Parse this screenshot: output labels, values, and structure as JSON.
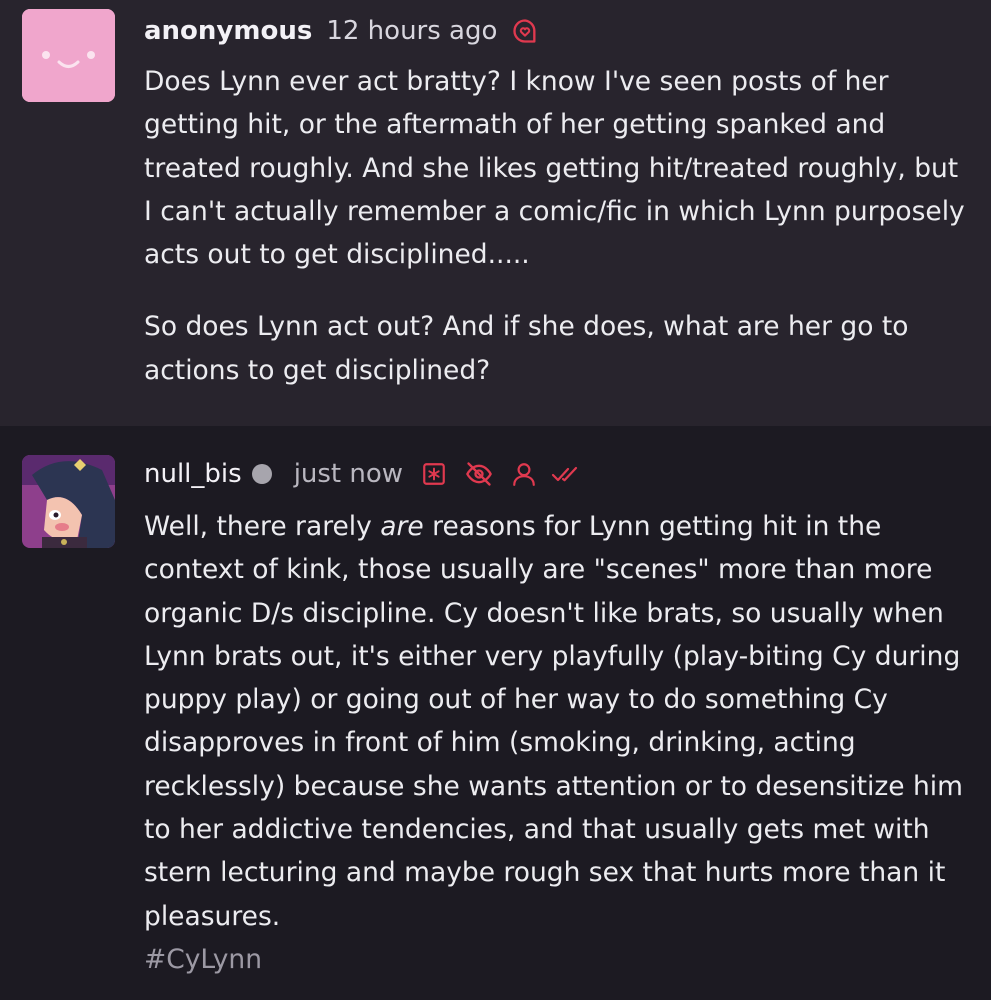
{
  "ask": {
    "username": "anonymous",
    "time": "12 hours ago",
    "paragraphs": [
      "Does Lynn ever act bratty? I know I've seen posts of her getting hit, or the aftermath of her getting spanked and treated roughly. And she likes getting hit/treated roughly, but I can't actually remember a comic/fic in which Lynn purposely acts out to get disciplined.....",
      "So does Lynn act out? And if she does, what are her go to actions to get disciplined?"
    ],
    "icons": {
      "avatar": "smiley-face-avatar",
      "ask": "speech-bubble-heart-icon"
    }
  },
  "answer": {
    "username": "null_bis",
    "time": "just now",
    "text_before": "Well, there rarely ",
    "emphasis": "are",
    "text_after": " reasons for Lynn getting hit in the context of kink, those usually are \"scenes\" more than more organic D/s discipline. Cy doesn't like brats, so usually when Lynn brats out, it's either very playfully (play-biting Cy during puppy play) or going out of her way to do something Cy disapproves in front of him (smoking, drinking, acting recklessly) because she wants attention or to desensitize him to her addictive tendencies, and that usually gets met with stern lecturing and maybe rough sex that hurts more than it pleasures.",
    "tag": "#CyLynn",
    "icons": [
      "asterisk-box-icon",
      "eye-off-icon",
      "user-icon",
      "double-check-icon"
    ]
  },
  "colors": {
    "accent": "#e0394f",
    "ask_bg": "#28242d",
    "answer_bg": "#1c1a22",
    "avatar_pink": "#f0a6cc"
  }
}
